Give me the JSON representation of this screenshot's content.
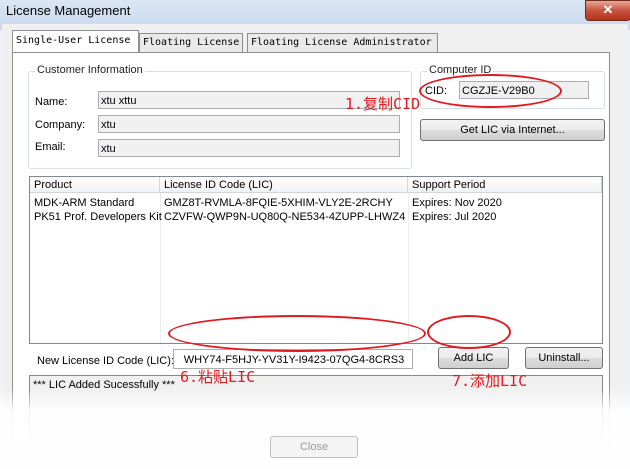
{
  "window": {
    "title": "License Management",
    "close_glyph": "✕"
  },
  "tabs": [
    "Single-User License",
    "Floating License",
    "Floating License Administrator"
  ],
  "customer": {
    "group_title": "Customer Information",
    "name_label": "Name:",
    "name_value": "xtu xttu",
    "company_label": "Company:",
    "company_value": "xtu",
    "email_label": "Email:",
    "email_value": "xtu"
  },
  "computer": {
    "group_title": "Computer ID",
    "cid_label": "CID:",
    "cid_value": "CGZJE-V29B0"
  },
  "buttons": {
    "get_lic": "Get LIC via Internet...",
    "add_lic": "Add LIC",
    "uninstall": "Uninstall...",
    "close": "Close"
  },
  "table": {
    "headers": [
      "Product",
      "License ID Code (LIC)",
      "Support Period"
    ],
    "rows": [
      [
        "MDK-ARM Standard",
        "GMZ8T-RVMLA-8FQIE-5XHIM-VLY2E-2RCHY",
        "Expires: Nov 2020"
      ],
      [
        "PK51 Prof. Developers Kit",
        "CZVFW-QWP9N-UQ80Q-NE534-4ZUPP-LHWZ4",
        "Expires: Jul 2020"
      ]
    ]
  },
  "new_lic": {
    "label": "New License ID Code (LIC):",
    "value": "WHY74-F5HJY-YV31Y-I9423-07QG4-8CRS3"
  },
  "message": "*** LIC Added Sucessfully ***",
  "annotations": {
    "copy_cid": "1.复制CID",
    "paste_lic": "6.粘贴LIC",
    "add_lic": "7.添加LIC"
  },
  "colors": {
    "annotation_red": "#e1191f"
  }
}
